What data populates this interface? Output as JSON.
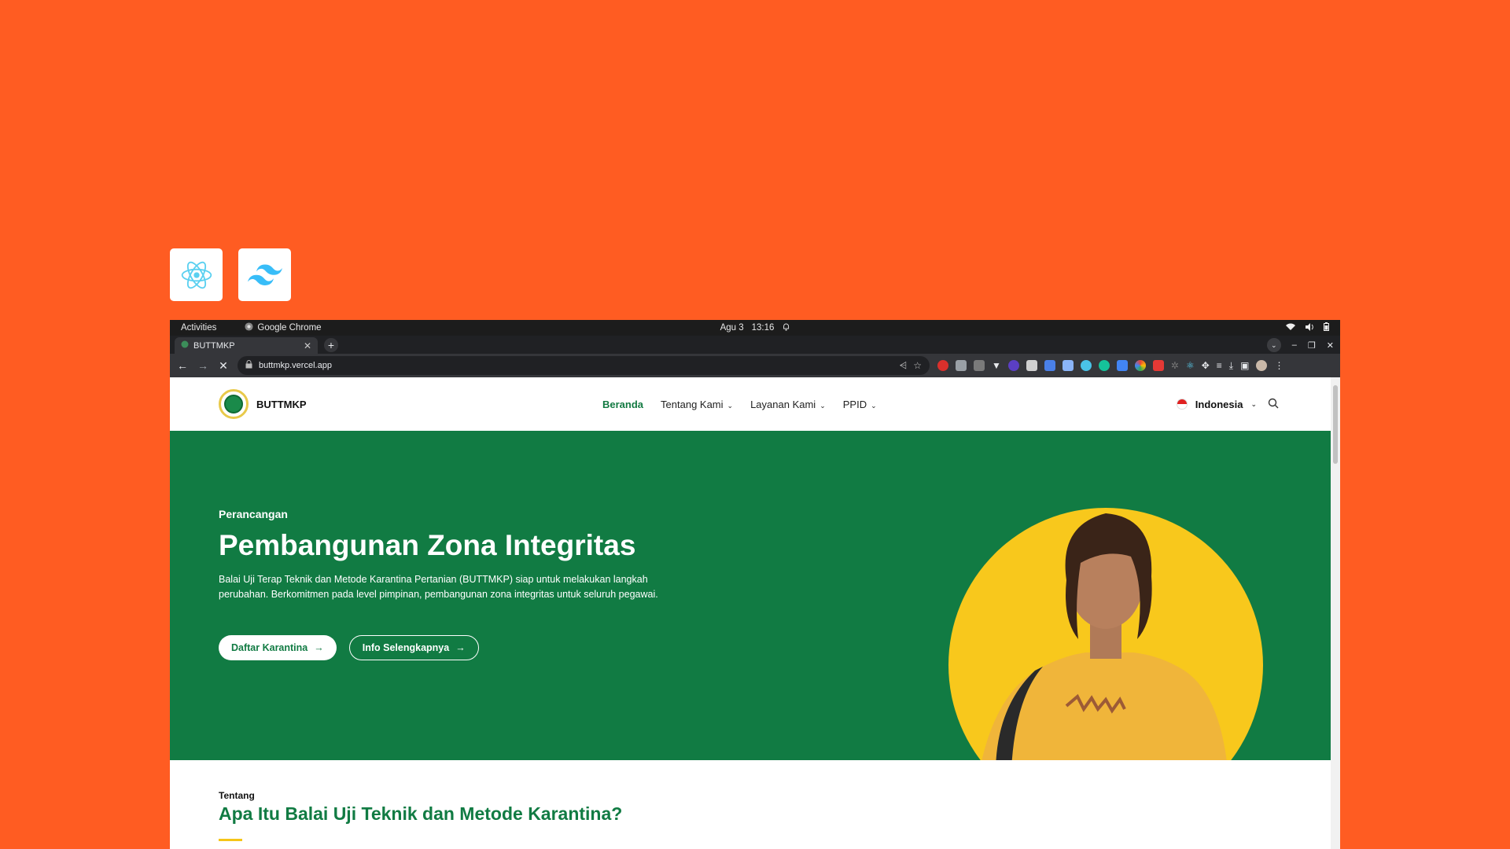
{
  "badges": [
    {
      "name": "react",
      "icon": "react-icon"
    },
    {
      "name": "tailwind",
      "icon": "tailwind-icon"
    }
  ],
  "os_bar": {
    "activities": "Activities",
    "app_name": "Google Chrome",
    "date": "Agu 3",
    "time": "13:16"
  },
  "browser": {
    "tab_title": "BUTTMKP",
    "url": "buttmkp.vercel.app"
  },
  "site": {
    "brand": "BUTTMKP",
    "nav": [
      {
        "label": "Beranda"
      },
      {
        "label": "Tentang Kami"
      },
      {
        "label": "Layanan Kami"
      },
      {
        "label": "PPID"
      }
    ],
    "language": "Indonesia"
  },
  "hero": {
    "eyebrow": "Perancangan",
    "title": "Pembangunan Zona Integritas",
    "description": "Balai Uji Terap Teknik dan Metode Karantina Pertanian (BUTTMKP) siap untuk melakukan langkah perubahan. Berkomitmen pada level pimpinan, pembangunan zona integritas untuk seluruh pegawai.",
    "primary_cta": "Daftar Karantina",
    "secondary_cta": "Info Selengkapnya"
  },
  "about": {
    "label": "Tentang",
    "title": "Apa Itu Balai Uji Teknik dan Metode Karantina?"
  },
  "colors": {
    "background": "#ff5c22",
    "brand_green": "#117b43",
    "accent_yellow": "#f5c518"
  }
}
